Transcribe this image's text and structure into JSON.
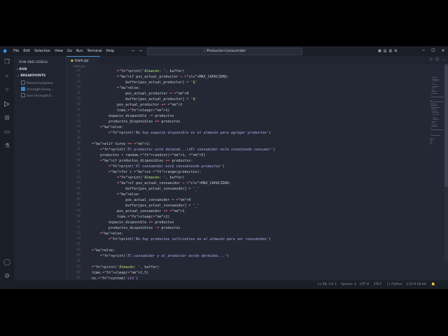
{
  "titlebar": {
    "menu": [
      "File",
      "Edit",
      "Selection",
      "View",
      "Go",
      "Run",
      "Terminal",
      "Help"
    ],
    "search": "Productor-Consumidor",
    "nav_back": "←",
    "nav_forward": "→"
  },
  "sidebar": {
    "header": "RUN AND DEBUG",
    "run_section": "RUN",
    "breakpoints_section": "BREAKPOINTS",
    "breakpoints": [
      {
        "label": "Raised Exceptions",
        "checked": false
      },
      {
        "label": "Uncaught Excep...",
        "checked": true
      },
      {
        "label": "User Uncaught E...",
        "checked": false
      }
    ]
  },
  "editor": {
    "tab_label": "main.py",
    "breadcrumb": "main.py › ..."
  },
  "code": {
    "first_line": 24,
    "lines": [
      "                print('Almacén: ', buffer)",
      "                if pos_actual_productor < MAX_CAPACIDAD:",
      "                    buffer[pos_actual_productor] = '$'",
      "                else:",
      "                    pos_actual_productor = 0",
      "                    buffer[pos_actual_productor] = '$'",
      "                pos_actual_productor += 1",
      "                time.sleep(1)",
      "            espacio_disponible -= productos",
      "            productos_disponibles += productos",
      "        else:",
      "            print('No hay espacio disponible en el almacén para agregar productos')",
      "",
      "    elif turno == 1:",
      "        print('El productor está dormido...\\nEl consumidor está intentando consumir')",
      "        productos = random.randint(1, 5)",
      "        if productos_disponibles >= productos:",
      "            print('El consumidor está consumiendo productos')",
      "            for i in range(productos):",
      "                print('Almacén: ', buffer)",
      "                if pos_actual_consumidor < MAX_CAPACIDAD:",
      "                    buffer[pos_actual_consumidor] = '_'",
      "                else:",
      "                    pos_actual_consumidor = 0",
      "                    buffer[pos_actual_consumidor] = '_'",
      "                pos_actual_consumidor += 1",
      "                time.sleep(1)",
      "            espacio_disponible += productos",
      "            productos_disponibles -= productos",
      "        else:",
      "            print('No hay productos suficientes en el almacén para ser consumidos')",
      "",
      "    else:",
      "        print('El consumidor y el productor están dormidos...')",
      "",
      "    print('Almacén: ', buffer)",
      "    time.sleep(2.5)",
      "    os.system('cls')",
      "    print()"
    ]
  },
  "statusbar": {
    "position": "Ln 68, Col 1",
    "spaces": "Spaces: 4",
    "encoding": "UTF-8",
    "eol": "CRLF",
    "language": "Python",
    "interpreter": "3.10.9 64-bit"
  },
  "colors": {
    "accent": "#2d9bf0",
    "keyword": "#f2b64d",
    "string": "#b7e07d",
    "number": "#ff9b61"
  }
}
